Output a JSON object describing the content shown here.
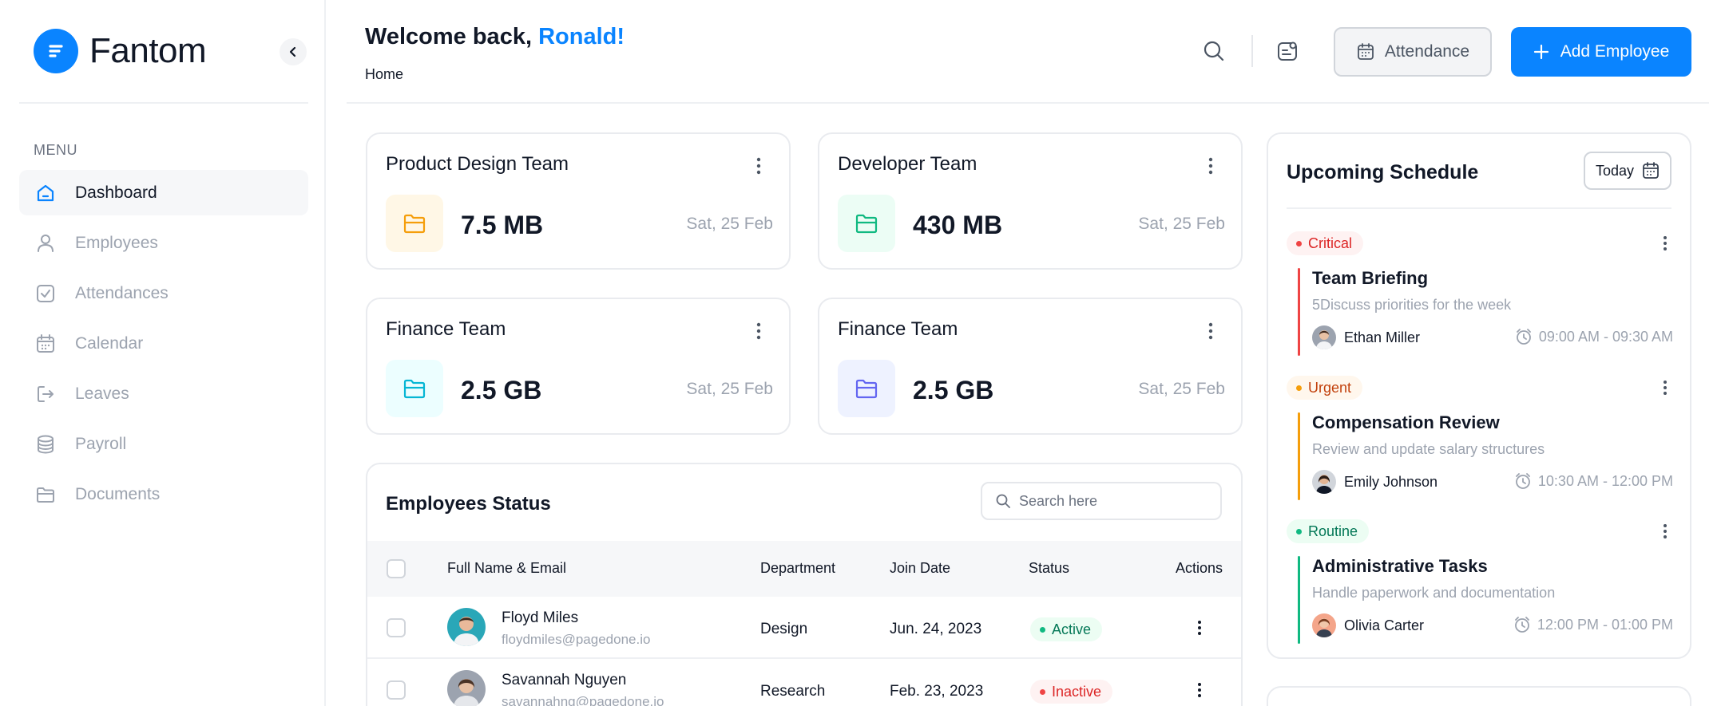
{
  "brand": {
    "name": "Fantom"
  },
  "sidebar": {
    "menu_title": "MENU",
    "items": [
      {
        "label": "Dashboard",
        "icon": "home-icon",
        "active": true
      },
      {
        "label": "Employees",
        "icon": "user-icon",
        "active": false
      },
      {
        "label": "Attendances",
        "icon": "checkbox-icon",
        "active": false
      },
      {
        "label": "Calendar",
        "icon": "calendar-icon",
        "active": false
      },
      {
        "label": "Leaves",
        "icon": "logout-icon",
        "active": false
      },
      {
        "label": "Payroll",
        "icon": "coins-icon",
        "active": false
      },
      {
        "label": "Documents",
        "icon": "folder-icon",
        "active": false
      }
    ]
  },
  "header": {
    "welcome": "Welcome back,",
    "user_name": "Ronald!",
    "breadcrumb": "Home",
    "attendance_label": "Attendance",
    "add_employee_label": "Add Employee"
  },
  "teams": [
    {
      "name": "Product Design Team",
      "size": "7.5 MB",
      "date": "Sat, 25 Feb",
      "color": "#f59e0b",
      "bg": "#fff7e6"
    },
    {
      "name": "Developer Team",
      "size": "430 MB",
      "date": "Sat, 25 Feb",
      "color": "#10b981",
      "bg": "#ecfdf5"
    },
    {
      "name": "Finance Team",
      "size": "2.5 GB",
      "date": "Sat, 25 Feb",
      "color": "#06b6d4",
      "bg": "#ecfeff"
    },
    {
      "name": "Finance Team",
      "size": "2.5 GB",
      "date": "Sat, 25 Feb",
      "color": "#6366f1",
      "bg": "#eef2ff"
    }
  ],
  "employees": {
    "title": "Employees Status",
    "search_placeholder": "Search here",
    "columns": [
      "Full Name & Email",
      "Department",
      "Join Date",
      "Status",
      "Actions"
    ],
    "rows": [
      {
        "name": "Floyd Miles",
        "email": "floydmiles@pagedone.io",
        "department": "Design",
        "join_date": "Jun. 24, 2023",
        "status": "Active"
      },
      {
        "name": "Savannah Nguyen",
        "email": "savannahng@pagedone.io",
        "department": "Research",
        "join_date": "Feb. 23, 2023",
        "status": "Inactive"
      }
    ]
  },
  "schedule": {
    "title": "Upcoming Schedule",
    "filter_label": "Today",
    "events": [
      {
        "tag": "Critical",
        "title": "Team Briefing",
        "description": "5Discuss priorities for the week",
        "person": "Ethan Miller",
        "time": "09:00 AM - 09:30 AM",
        "line_color": "#ef4444"
      },
      {
        "tag": "Urgent",
        "title": "Compensation Review",
        "description": "Review and update salary structures",
        "person": "Emily Johnson",
        "time": "10:30 AM - 12:00 PM",
        "line_color": "#f59e0b"
      },
      {
        "tag": "Routine",
        "title": "Administrative Tasks",
        "description": "Handle paperwork and documentation",
        "person": "Olivia Carter",
        "time": "12:00 PM - 01:00 PM",
        "line_color": "#10b981"
      }
    ]
  },
  "colors": {
    "accent": "#0a84ff"
  }
}
